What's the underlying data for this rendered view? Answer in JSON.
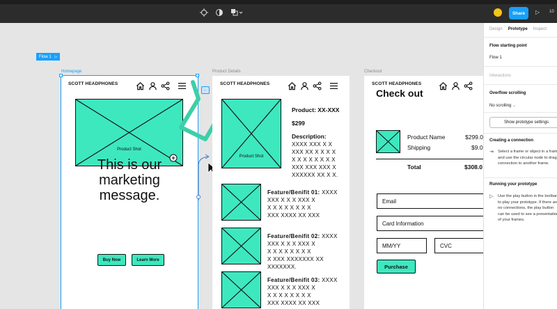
{
  "toolbar": {
    "share_label": "Share",
    "zoom_label": "10"
  },
  "canvas": {
    "flow_tag": "Flow 1",
    "frames": {
      "homepage": "Homepage",
      "product_details": "Product Details",
      "checkout": "Checkout"
    }
  },
  "homepage": {
    "brand": "SCOTT HEADPHONES",
    "hero_label": "Product Shot",
    "marketing": [
      "This is our",
      "marketing",
      "message."
    ],
    "buy_now": "Buy Now",
    "learn_more": "Learn More"
  },
  "product": {
    "brand": "SCOTT HEADPHONES",
    "image_label": "Product Shot",
    "product_line": "Product: XX-XXX",
    "price": "$299",
    "description_title": "Description:",
    "description_lines": [
      "XXXX XXX X X",
      "XXX XX X X X X",
      "X X X X X X X X",
      "XXX XXX XXX X",
      "XXXXXX XX X X."
    ],
    "features": [
      {
        "title": "Feature/Benifit 01:",
        "first": "XXXX",
        "lines": [
          "XXX X X X XXX X",
          "X X X X X X X X",
          "XXX XXXX XX XXX"
        ]
      },
      {
        "title": "Feature/Benifit 02:",
        "first": "XXXX",
        "lines": [
          "XXX X X X XXX X",
          "X X X X X X X X",
          "X XXX XXXXXXX XX",
          "XXXXXXX."
        ]
      },
      {
        "title": "Feature/Benifit 03:",
        "first": "XXXX",
        "lines": [
          "XXX X X X XXX X",
          "X X X X X X X X",
          "XXX XXXX XX XXX"
        ]
      }
    ]
  },
  "checkout": {
    "brand": "SCOTT HEADPHONES",
    "title": "Check out",
    "product_name_label": "Product Name",
    "product_name_value": "$299.0",
    "shipping_label": "Shipping",
    "shipping_value": "$9.0",
    "total_label": "Total",
    "total_value": "$308.0",
    "email_placeholder": "Email",
    "card_placeholder": "Card Information",
    "date_placeholder": "MM/YY",
    "cvc_placeholder": "CVC",
    "purchase": "Purchase"
  },
  "panel": {
    "tabs": [
      "Design",
      "Prototype",
      "Inspect"
    ],
    "active_tab": "Prototype",
    "flow_start_title": "Flow starting point",
    "flow_start_value": "Flow 1",
    "interactions": "Interactions",
    "overflow_title": "Overflow scrolling",
    "overflow_value": "No scrolling",
    "settings_button": "Show prototype settings",
    "creating_title": "Creating a connection",
    "creating_desc": "Select a frame or object in a frame and use the circular node to drag a connection to another frame.",
    "running_title": "Running your prototype",
    "running_desc": "Use the play button in the toolbar to play your prototype. If there are no connections, the play button can be used to see a presentation of your frames."
  },
  "colors": {
    "accent": "#18a0fb",
    "wireframe_fill": "#3de8bf",
    "toolbar": "#2c2c2c",
    "arrow": "#3ccfa8"
  }
}
